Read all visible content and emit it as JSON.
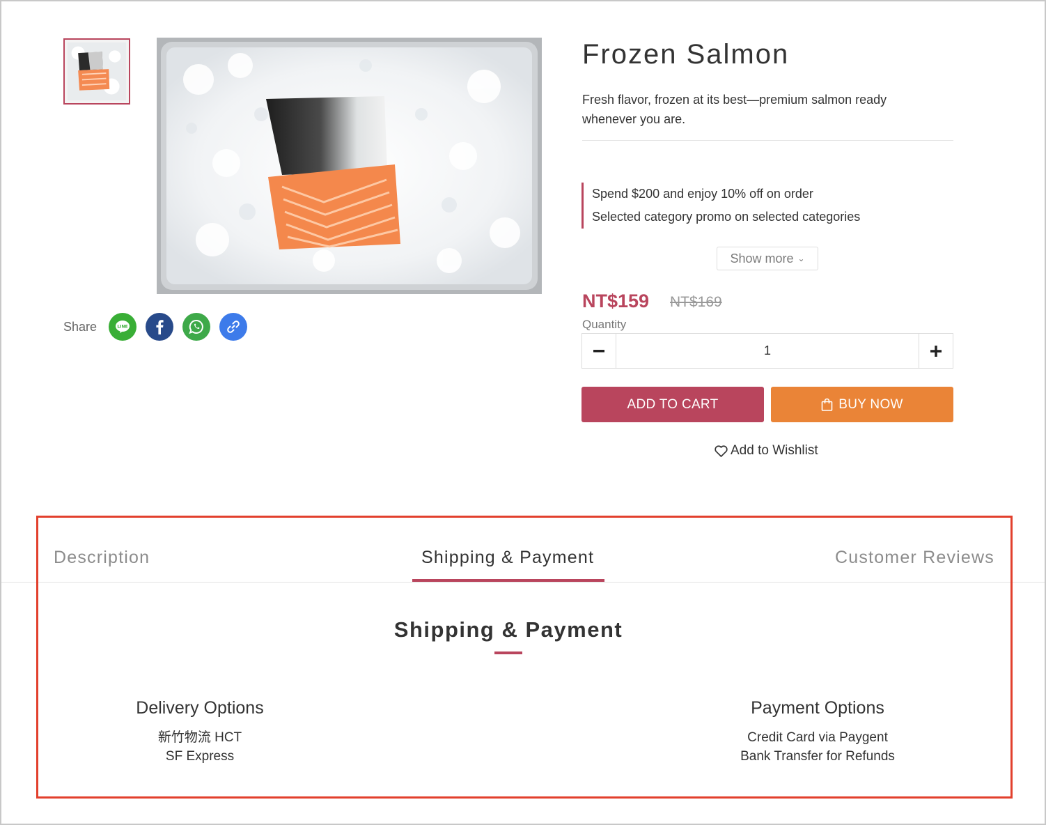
{
  "product": {
    "title": "Frozen Salmon",
    "subtitle": "Fresh flavor, frozen at its best—premium salmon ready whenever you are.",
    "promotions": [
      "Spend $200 and enjoy 10% off on order",
      "Selected category promo on selected categories"
    ],
    "show_more_label": "Show more",
    "price": "NT$159",
    "original_price": "NT$169",
    "quantity_label": "Quantity",
    "quantity": "1",
    "add_to_cart_label": "ADD TO CART",
    "buy_now_label": "BUY NOW",
    "wishlist_label": "Add to Wishlist"
  },
  "gallery": {
    "thumbnail_icon": "salmon-thumbnail-image",
    "main_image_icon": "salmon-on-ice-image"
  },
  "share": {
    "label": "Share",
    "buttons": [
      {
        "icon": "line-icon",
        "color": "#39ae36"
      },
      {
        "icon": "facebook-icon",
        "color": "#284a8a"
      },
      {
        "icon": "whatsapp-icon",
        "color": "#3ea949"
      },
      {
        "icon": "link-icon",
        "color": "#3d7bea"
      }
    ]
  },
  "tabs": [
    {
      "label": "Description",
      "active": false
    },
    {
      "label": "Shipping & Payment",
      "active": true
    },
    {
      "label": "Customer Reviews",
      "active": false
    }
  ],
  "shipping_payment": {
    "title": "Shipping & Payment",
    "delivery": {
      "title": "Delivery Options",
      "items": [
        "新竹物流 HCT",
        "SF Express"
      ]
    },
    "payment": {
      "title": "Payment Options",
      "items": [
        "Credit Card via Paygent",
        "Bank Transfer for Refunds"
      ]
    }
  },
  "colors": {
    "accent": "#b9455d",
    "buy_now": "#ea8437",
    "highlight_box": "#e2402d"
  }
}
